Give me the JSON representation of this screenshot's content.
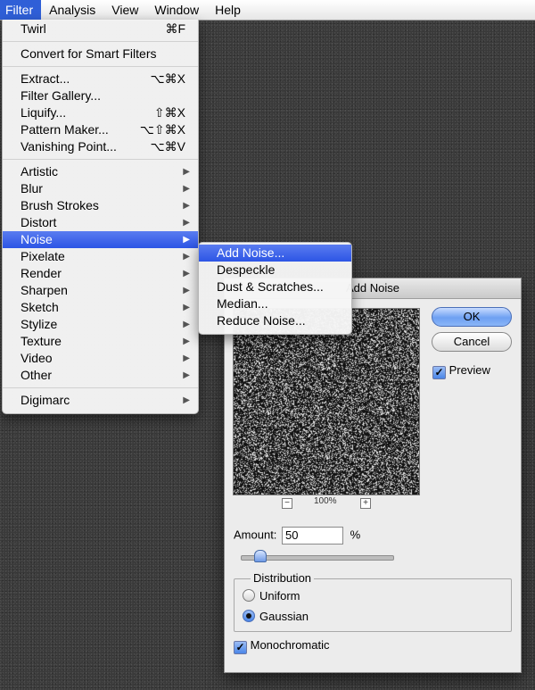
{
  "menubar": {
    "items": [
      "Filter",
      "Analysis",
      "View",
      "Window",
      "Help"
    ]
  },
  "filter_menu": {
    "twirl": {
      "label": "Twirl",
      "shortcut": "⌘F"
    },
    "convert": {
      "label": "Convert for Smart Filters"
    },
    "extract": {
      "label": "Extract...",
      "shortcut": "⌥⌘X"
    },
    "filter_gallery": {
      "label": "Filter Gallery..."
    },
    "liquify": {
      "label": "Liquify...",
      "shortcut": "⇧⌘X"
    },
    "pattern_maker": {
      "label": "Pattern Maker...",
      "shortcut": "⌥⇧⌘X"
    },
    "vanishing_point": {
      "label": "Vanishing Point...",
      "shortcut": "⌥⌘V"
    },
    "categories": [
      "Artistic",
      "Blur",
      "Brush Strokes",
      "Distort",
      "Noise",
      "Pixelate",
      "Render",
      "Sharpen",
      "Sketch",
      "Stylize",
      "Texture",
      "Video",
      "Other"
    ],
    "digimarc": {
      "label": "Digimarc"
    }
  },
  "noise_submenu": {
    "items": [
      "Add Noise...",
      "Despeckle",
      "Dust & Scratches...",
      "Median...",
      "Reduce Noise..."
    ]
  },
  "dialog": {
    "title": "Add Noise",
    "ok_label": "OK",
    "cancel_label": "Cancel",
    "preview_label": "Preview",
    "zoom_minus": "−",
    "zoom_plus": "+",
    "zoom_level": "100%",
    "amount_label": "Amount:",
    "amount_value": "50",
    "amount_unit": "%",
    "amount_slider_fraction": 0.12,
    "distribution_label": "Distribution",
    "uniform_label": "Uniform",
    "gaussian_label": "Gaussian",
    "monochromatic_label": "Monochromatic"
  },
  "colors": {
    "menu_highlight": "#2f5fd7",
    "ok_button": "#6ea0f2"
  }
}
